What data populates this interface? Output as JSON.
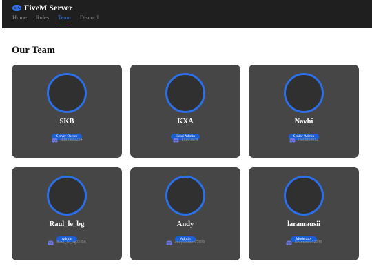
{
  "brand": {
    "title": "FiveM Server",
    "icon": "gamepad-icon",
    "color": "#2f6fe0"
  },
  "nav": {
    "items": [
      {
        "label": "Home",
        "active": false
      },
      {
        "label": "Rules",
        "active": false
      },
      {
        "label": "Team",
        "active": true
      },
      {
        "label": "Discord",
        "active": false
      }
    ]
  },
  "section": {
    "title": "Our Team"
  },
  "team": [
    {
      "name": "SKB",
      "role": "Server Owner",
      "discord": "skb00e01234"
    },
    {
      "name": "KXA",
      "role": "Head Admin",
      "discord": "kxa05678"
    },
    {
      "name": "Navhi",
      "role": "Senior Admin",
      "discord": "Navhi09012"
    },
    {
      "name": "Raul_le_bg",
      "role": "Admin",
      "discord": "Raul_le_bg03456"
    },
    {
      "name": "Andy",
      "role": "Admin",
      "discord": "andyklouter07890"
    },
    {
      "name": "laramausii",
      "role": "Moderator",
      "discord": "laramausii02345"
    }
  ],
  "colors": {
    "accent": "#2d6fe6",
    "card_bg": "#464646",
    "navbar_bg": "#1f1f1f",
    "badge_bg": "#1a5fd4",
    "discord_icon": "#6c78e6"
  }
}
